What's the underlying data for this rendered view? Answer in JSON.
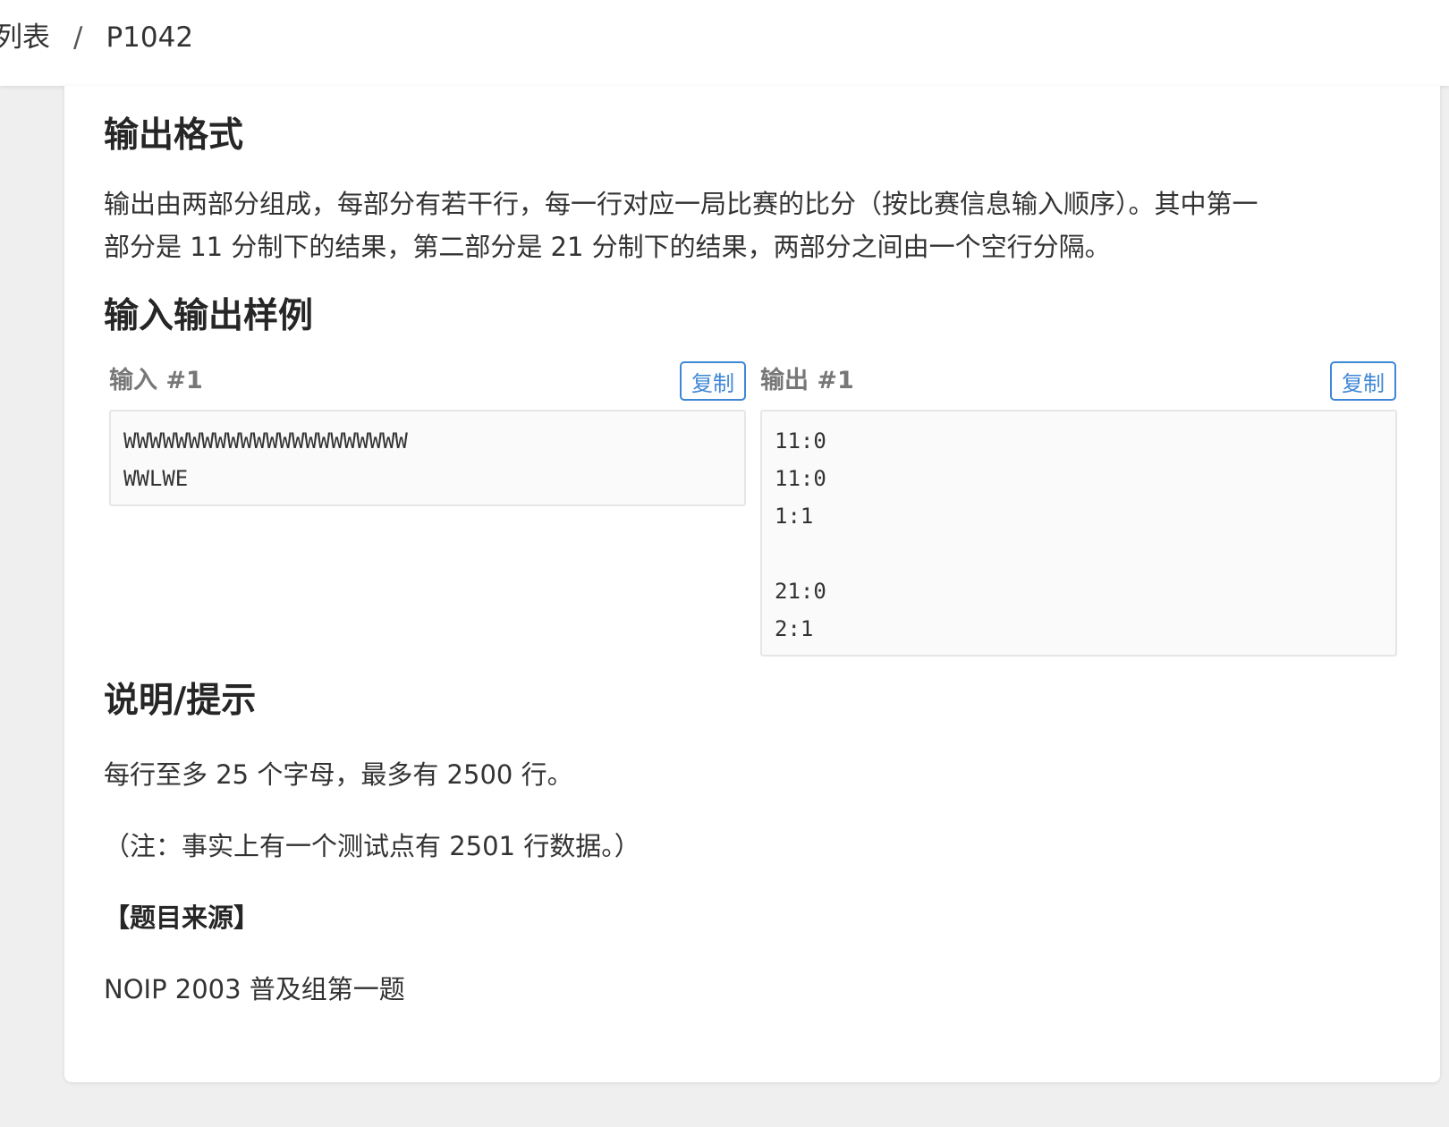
{
  "breadcrumb": {
    "parent": "列表",
    "separator": "/",
    "current": "P1042"
  },
  "output_format": {
    "heading": "输出格式",
    "text_line1": "输出由两部分组成，每部分有若干行，每一行对应一局比赛的比分（按比赛信息输入顺序）。其中第一",
    "text_line2": "部分是 11 分制下的结果，第二部分是 21 分制下的结果，两部分之间由一个空行分隔。"
  },
  "samples": {
    "heading": "输入输出样例",
    "input_label": "输入 #1",
    "output_label": "输出 #1",
    "copy_label": "复制",
    "input_lines": [
      "WWWWWWWWWWWWWWWWWWWWWW",
      "WWLWE"
    ],
    "output_lines": [
      "11:0",
      "11:0",
      "1:1",
      "",
      "21:0",
      "2:1"
    ]
  },
  "hints": {
    "heading": "说明/提示",
    "line1": "每行至多 25 个字母，最多有 2500 行。",
    "line2": "（注：事实上有一个测试点有 2501 行数据。）",
    "source_title": "【题目来源】",
    "source": "NOIP 2003 普及组第一题"
  }
}
